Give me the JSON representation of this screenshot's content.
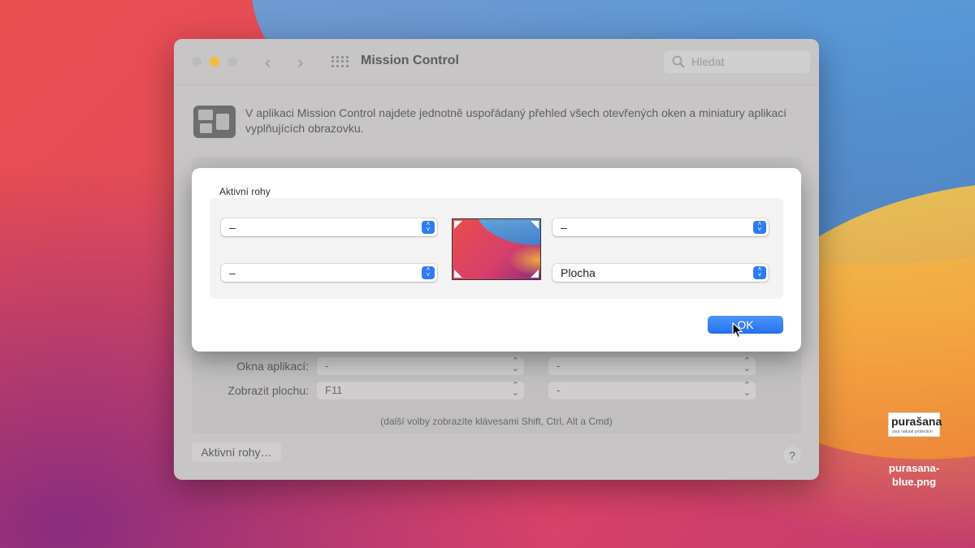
{
  "window": {
    "title": "Mission Control",
    "search_placeholder": "Hledat",
    "nav_back": "‹",
    "nav_forward": "›"
  },
  "description": "V aplikaci Mission Control najdete jednotně uspořádaný přehled všech otevřených oken a miniatury aplikací vyplňujících obrazovku.",
  "shortcuts": {
    "rows": [
      {
        "label": "Okna aplikací:",
        "key": "-",
        "mouse": "-"
      },
      {
        "label": "Zobrazit plochu:",
        "key": "F11",
        "mouse": "-"
      }
    ],
    "hint": "(další volby zobrazíte klávesami Shift, Ctrl, Alt a Cmd)"
  },
  "buttons": {
    "active_corners": "Aktivní rohy…",
    "help": "?"
  },
  "sheet": {
    "title": "Aktivní rohy",
    "top_left": "–",
    "bottom_left": "–",
    "top_right": "–",
    "bottom_right": "Plocha",
    "ok": "OK"
  },
  "watermark": {
    "logo": "purašana",
    "logo_tagline": "your natural protection",
    "caption": "purasana-blue.png"
  },
  "colors": {
    "accent": "#2f7bf6",
    "minimize_light": "#f1bf38"
  }
}
